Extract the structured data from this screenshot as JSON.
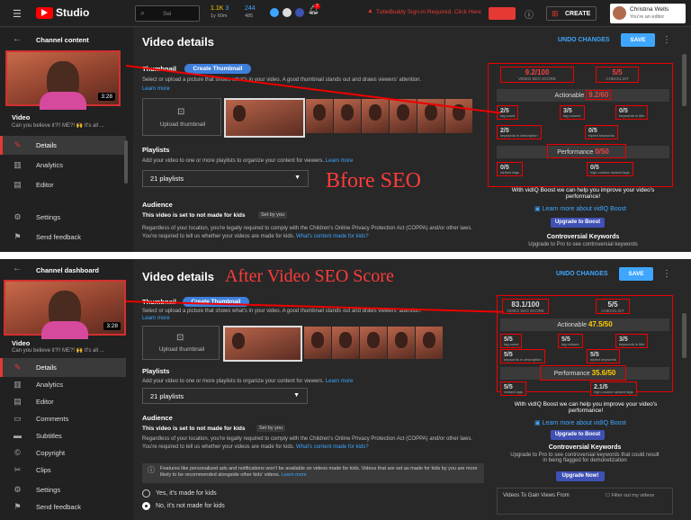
{
  "topbar": {
    "logo": "Studio",
    "search_placeholder": "Sei",
    "stats": [
      "1.1K",
      "3",
      "244",
      "1y",
      "60m",
      "485"
    ],
    "notice": "TubeBuddy Sign-in Required. Click Here",
    "create": "CREATE",
    "user_name": "Christina Wells",
    "user_role": "You're an editor",
    "bell_badge": "7"
  },
  "top": {
    "sidebar": {
      "header": "Channel content",
      "video_duration": "3:28",
      "video_label": "Video",
      "video_title": "Can you believe it?!! ME?! 🙌 It's all ...",
      "items": [
        "Details",
        "Analytics",
        "Editor",
        "Settings",
        "Send feedback"
      ]
    },
    "title": "Video details",
    "undo": "UNDO CHANGES",
    "save": "SAVE",
    "thumbnail_label": "Thumbnail",
    "create_thumb": "Create Thumbnail",
    "thumb_desc": "Select or upload a picture that shows what's in your video. A good thumbnail stands out and draws viewers' attention.",
    "learn_more": "Learn more",
    "upload_thumb": "Upload thumbnail",
    "playlists_label": "Playlists",
    "playlists_desc": "Add your video to one or more playlists to organize your content for viewers.",
    "playlists_link": "Learn more",
    "playlists_value": "21 playlists",
    "audience_label": "Audience",
    "audience_status": "This video is set to not made for kids",
    "audience_tag": "Set by you",
    "audience_desc": "Regardless of your location, you're legally required to comply with the Children's Online Privacy Protection Act (COPPA) and/or other laws. You're required to tell us whether your videos are made for kids.",
    "audience_link": "What's content made for kids?",
    "overlay_text": "Bfore SEO",
    "seo": {
      "score": "9.2/100",
      "score_label": "VIDEO SEO SCORE",
      "checklist": "5/5",
      "checklist_label": "CHECKLIST",
      "actionable_label": "Actionable",
      "actionable_value": "9.2/60",
      "metrics": [
        {
          "v": "2/5",
          "l": "tag count"
        },
        {
          "v": "3/5",
          "l": "tag volume"
        },
        {
          "v": "0/5",
          "l": "keywords in title"
        },
        {
          "v": "2/5",
          "l": "keywords in description"
        },
        {
          "v": "0/5",
          "l": "tripled keywords"
        }
      ],
      "performance_label": "Performance",
      "performance_value": "0/50",
      "perf_metrics": [
        {
          "v": "0/5",
          "l": "ranked tags"
        },
        {
          "v": "0/5",
          "l": "high volume ranked tags"
        }
      ]
    },
    "boost_text": "With vidIQ Boost we can help you improve your video's performance!",
    "boost_learn": "Learn more about vidIQ Boost",
    "boost_btn": "Upgrade to Boost",
    "controversial_title": "Controversial Keywords",
    "controversial_desc": "Upgrade to Pro to see controversial keywords"
  },
  "bot": {
    "sidebar": {
      "header": "Channel dashboard",
      "video_duration": "3:28",
      "video_label": "Video",
      "video_title": "Can you believe it?!! ME?! 🙌 It's all ...",
      "items": [
        "Details",
        "Analytics",
        "Editor",
        "Comments",
        "Subtitles",
        "Copyright",
        "Clips",
        "Settings",
        "Send feedback"
      ]
    },
    "title": "Video details",
    "overlay_text": "After Video SEO Score",
    "undo": "UNDO CHANGES",
    "save": "SAVE",
    "thumbnail_label": "Thumbnail",
    "create_thumb": "Create Thumbnail",
    "thumb_desc": "Select or upload a picture that shows what's in your video. A good thumbnail stands out and draws viewers' attention.",
    "learn_more": "Learn more",
    "upload_thumb": "Upload thumbnail",
    "playlists_label": "Playlists",
    "playlists_desc": "Add your video to one or more playlists to organize your content for viewers.",
    "playlists_link": "Learn more",
    "playlists_value": "21 playlists",
    "audience_label": "Audience",
    "audience_status": "This video is set to not made for kids",
    "audience_tag": "Set by you",
    "audience_desc": "Regardless of your location, you're legally required to comply with the Children's Online Privacy Protection Act (COPPA) and/or other laws. You're required to tell us whether your videos are made for kids.",
    "audience_link": "What's content made for kids?",
    "info_note": "Features like personalized ads and notifications won't be available on videos made for kids. Videos that are set as made for kids by you are more likely to be recommended alongside other kids' videos.",
    "info_link": "Learn more",
    "radio_yes": "Yes, it's made for kids",
    "radio_no": "No, it's not made for kids",
    "seo": {
      "score": "83.1/100",
      "score_label": "VIDEO SEO SCORE",
      "checklist": "5/5",
      "checklist_label": "CHECKLIST",
      "actionable_label": "Actionable",
      "actionable_value": "47.5/50",
      "metrics": [
        {
          "v": "5/5",
          "l": "tag count"
        },
        {
          "v": "5/5",
          "l": "tag volume"
        },
        {
          "v": "3/5",
          "l": "keywords in title"
        },
        {
          "v": "5/5",
          "l": "keywords in description"
        },
        {
          "v": "5/5",
          "l": "tripled keywords"
        }
      ],
      "performance_label": "Performance",
      "performance_value": "35.6/50",
      "perf_metrics": [
        {
          "v": "5/5",
          "l": "ranked tags"
        },
        {
          "v": "2.1/5",
          "l": "high volume ranked tags"
        }
      ]
    },
    "boost_text": "With vidIQ Boost we can help you improve your video's performance!",
    "boost_learn": "Learn more about vidIQ Boost",
    "boost_btn": "Upgrade to Boost",
    "controversial_title": "Controversial Keywords",
    "controversial_desc": "Upgrade to Pro to see controversial keywords that could result in being flagged for demonetization",
    "upgrade_now": "Upgrade Now!",
    "gain_views": "Videos To Gain Views From",
    "filter": "Filter out my videos"
  }
}
